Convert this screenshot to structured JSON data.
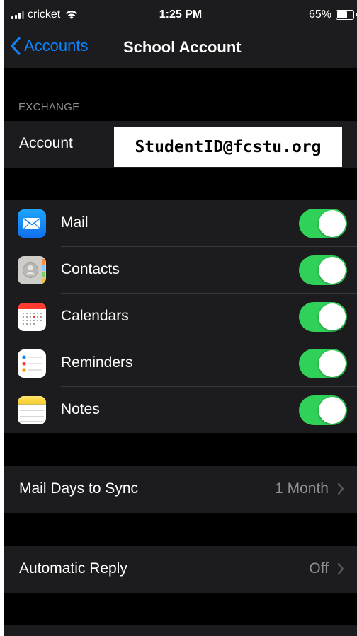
{
  "status_bar": {
    "carrier": "cricket",
    "time": "1:25 PM",
    "battery": "65%"
  },
  "nav": {
    "back_label": "Accounts",
    "title": "School Account"
  },
  "exchange": {
    "section_label": "EXCHANGE",
    "account_label": "Account",
    "account_value": "StudentID@fcstu.org"
  },
  "sync_items": [
    {
      "label": "Mail",
      "icon": "mail-icon",
      "enabled": true
    },
    {
      "label": "Contacts",
      "icon": "contacts-icon",
      "enabled": true
    },
    {
      "label": "Calendars",
      "icon": "calendar-icon",
      "enabled": true
    },
    {
      "label": "Reminders",
      "icon": "reminders-icon",
      "enabled": true
    },
    {
      "label": "Notes",
      "icon": "notes-icon",
      "enabled": true
    }
  ],
  "mail_days": {
    "label": "Mail Days to Sync",
    "value": "1 Month"
  },
  "auto_reply": {
    "label": "Automatic Reply",
    "value": "Off"
  },
  "colors": {
    "accent": "#0a84ff",
    "toggle_on": "#30d158",
    "background": "#000000",
    "cell": "#1c1c1e",
    "secondary_text": "#8e8e93"
  }
}
